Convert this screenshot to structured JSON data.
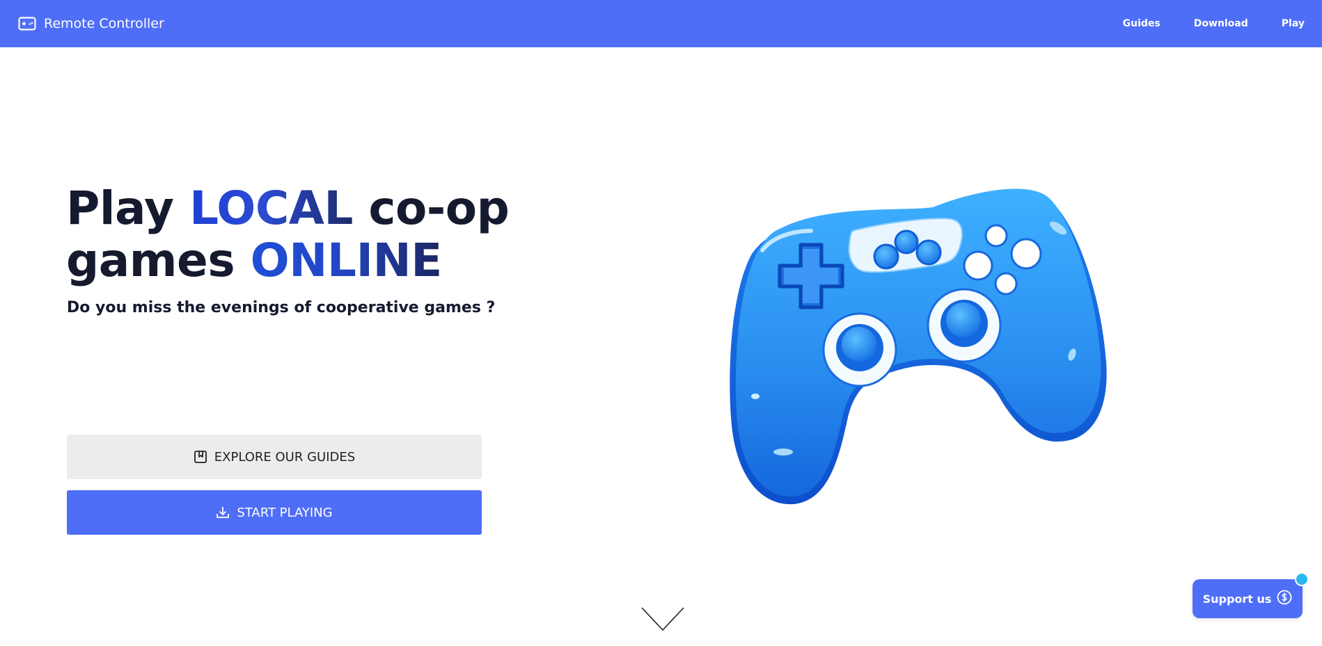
{
  "app": {
    "brand_name": "Remote Controller",
    "brand_icon": "gamepad-icon"
  },
  "nav": {
    "items": [
      {
        "label": "Guides"
      },
      {
        "label": "Download"
      },
      {
        "label": "Play"
      }
    ]
  },
  "hero": {
    "title_word_1": "Play ",
    "title_highlight_1": "LOCAL",
    "title_word_2": " co-op",
    "title_word_3": "games ",
    "title_highlight_2": "ONLINE",
    "subtitle": "Do you miss the evenings of cooperative games ?"
  },
  "buttons": {
    "guides_label": "EXPLORE OUR GUIDES",
    "guides_icon": "bookmark-icon",
    "play_label": "START PLAYING",
    "play_icon": "download-icon"
  },
  "illustration": {
    "name": "blue-gamepad-illustration"
  },
  "scroll": {
    "icon": "chevron-down-icon"
  },
  "support": {
    "label": "Support us",
    "icon": "dollar-coin-icon"
  },
  "colors": {
    "primary": "#4f6ef7",
    "text_dark": "#161a2e",
    "highlight_blue": "#2246c7",
    "secondary_button": "#ececec",
    "notification_dot": "#2bb7f0"
  }
}
